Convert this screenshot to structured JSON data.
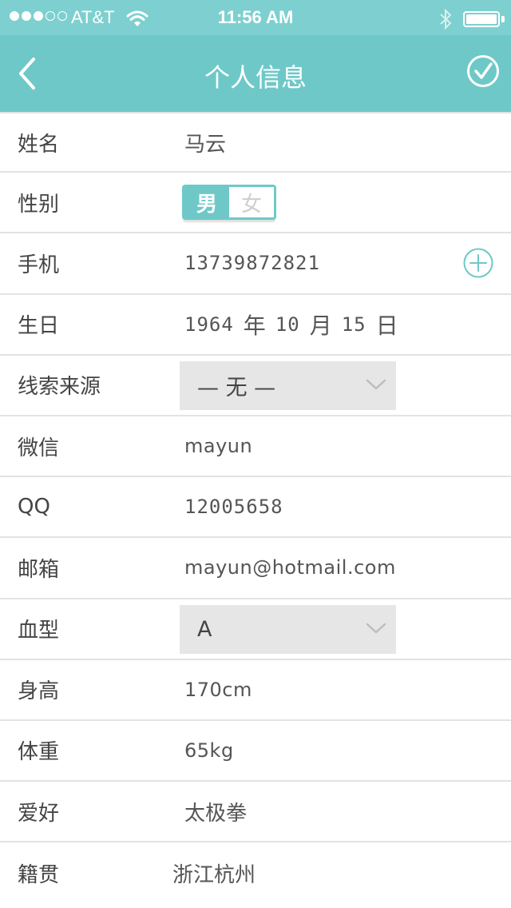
{
  "status_bar": {
    "carrier": "AT&T",
    "time": "11:56 AM"
  },
  "nav": {
    "title": "个人信息"
  },
  "colors": {
    "accent": "#6fc8c8",
    "status_bar": "#7ed0d0",
    "select_bg": "#e6e6e6",
    "divider": "#e3e3e3"
  },
  "form": {
    "name": {
      "label": "姓名",
      "value": "马云"
    },
    "gender": {
      "label": "性别",
      "options": [
        "男",
        "女"
      ],
      "selected": "男"
    },
    "phone": {
      "label": "手机",
      "value": "13739872821",
      "add_icon": "plus-circle-icon"
    },
    "birthday": {
      "label": "生日",
      "year": "1964",
      "year_unit": "年",
      "month": "10",
      "month_unit": "月",
      "day": "15",
      "day_unit": "日"
    },
    "lead_source": {
      "label": "线索来源",
      "value": "— 无 —"
    },
    "wechat": {
      "label": "微信",
      "value": "mayun"
    },
    "qq": {
      "label": "QQ",
      "value": "12005658"
    },
    "email": {
      "label": "邮箱",
      "value": "mayun@hotmail.com"
    },
    "blood_type": {
      "label": "血型",
      "value": "A"
    },
    "height": {
      "label": "身高",
      "value": "170cm"
    },
    "weight": {
      "label": "体重",
      "value": "65kg"
    },
    "hobby": {
      "label": "爱好",
      "value": "太极拳"
    },
    "hometown": {
      "label": "籍贯",
      "value": "浙江杭州"
    }
  }
}
